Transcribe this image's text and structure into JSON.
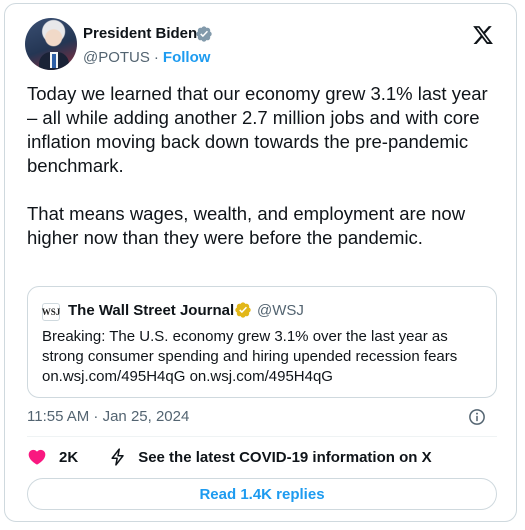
{
  "author": {
    "name": "President Biden",
    "handle": "@POTUS",
    "separator": "·",
    "follow_label": "Follow"
  },
  "tweet": {
    "paragraphs": [
      "Today we learned that our economy grew 3.1% last year – all while adding another 2.7 million jobs and with core inflation moving back down towards the pre-pandemic benchmark.",
      "That means wages, wealth, and employment are now higher now than they were before the pandemic."
    ]
  },
  "quote": {
    "logo_text": "WSJ",
    "name": "The Wall Street Journal",
    "handle": "@WSJ",
    "text": "Breaking: The U.S. economy grew 3.1% over the last year as strong consumer spending and hiring upended recession fears on.wsj.com/495H4qG on.wsj.com/495H4qG"
  },
  "meta": {
    "timestamp": "11:55 AM · Jan 25, 2024"
  },
  "actions": {
    "like_count": "2K",
    "covid_link": "See the latest COVID-19 information on X"
  },
  "replies_button": "Read 1.4K replies",
  "colors": {
    "accent": "#1d9bf0",
    "verified_gold": "#e2b719",
    "heart": "#f91880",
    "text": "#0f1419",
    "secondary": "#536471"
  },
  "icons": [
    "verified-badge-icon",
    "x-logo-icon",
    "info-icon",
    "heart-icon",
    "bolt-icon"
  ]
}
